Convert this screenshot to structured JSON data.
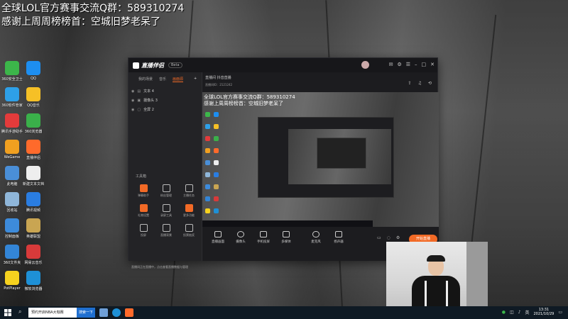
{
  "overlay": {
    "line1": "全球LOL官方赛事交流Q群：589310274",
    "line2": "感谢上周周榜榜首：空城旧梦老呆了"
  },
  "desktop_icons": [
    {
      "label": "360安全卫士",
      "color": "#3cb64a",
      "icon": "shield-icon"
    },
    {
      "label": "QQ",
      "color": "#1d8ef0",
      "icon": "qq-icon"
    },
    {
      "label": "360软件管家",
      "color": "#2ea0e8",
      "icon": "app-store-icon"
    },
    {
      "label": "QQ音乐",
      "color": "#f6c026",
      "icon": "music-icon"
    },
    {
      "label": "腾讯手游助手",
      "color": "#e33b3b",
      "icon": "game-icon"
    },
    {
      "label": "360浏览器",
      "color": "#3ab04a",
      "icon": "browser-icon"
    },
    {
      "label": "WeGame",
      "color": "#f0a020",
      "icon": "wegame-icon"
    },
    {
      "label": "直播伴侣",
      "color": "#ff6a2b",
      "icon": "live-companion-icon"
    },
    {
      "label": "此电脑",
      "color": "#4a8fd8",
      "icon": "computer-icon"
    },
    {
      "label": "新建文本文档",
      "color": "#eeeeee",
      "icon": "text-file-icon"
    },
    {
      "label": "回收站",
      "color": "#8fb6d9",
      "icon": "recycle-bin-icon"
    },
    {
      "label": "腾讯视频",
      "color": "#2a7de1",
      "icon": "video-icon"
    },
    {
      "label": "控制面板",
      "color": "#3d8bdb",
      "icon": "control-panel-icon"
    },
    {
      "label": "英雄联盟",
      "color": "#c9a552",
      "icon": "lol-icon"
    },
    {
      "label": "360文件夹",
      "color": "#3385d6",
      "icon": "folder-icon"
    },
    {
      "label": "网易云音乐",
      "color": "#d83a3a",
      "icon": "netease-music-icon"
    },
    {
      "label": "PotPlayer",
      "color": "#f6d21f",
      "icon": "player-icon"
    },
    {
      "label": "微软浏览器",
      "color": "#1e90d6",
      "icon": "edge-icon"
    }
  ],
  "app": {
    "name": "直播伴侣",
    "version": "Beta",
    "left_tabs": [
      "我的场景",
      "音乐",
      "画面源"
    ],
    "scenes": [
      "文本 4",
      "摄像头 3",
      "全屏 2"
    ],
    "tools_title": "工具箱",
    "tools": [
      "弹幕助手",
      "粉丝管理",
      "主播任务",
      "礼物设置",
      "录屏工具",
      "更多功能",
      "投屏",
      "直播背景",
      "投票抽奖"
    ],
    "notice": "直播间正在直播中，点击查看直播数据与管理",
    "room_title": "直播间 抖音直播",
    "room_sub": "直播间ID：2121242",
    "preview_line1": "全球LOL官方赛事交流Q群：589310274",
    "preview_line2": "感谢上周周榜榜首：空城旧梦老呆了",
    "bottom_tools": [
      "直播画面",
      "摄像头",
      "手机投屏",
      "多媒体",
      "麦克风",
      "扬声器"
    ],
    "start_button": "开始直播"
  },
  "taskbar": {
    "search_text": "预约开启NBA大咖赛",
    "search_button": "搜索一下",
    "time": "13:31",
    "date": "2021/10/29"
  }
}
